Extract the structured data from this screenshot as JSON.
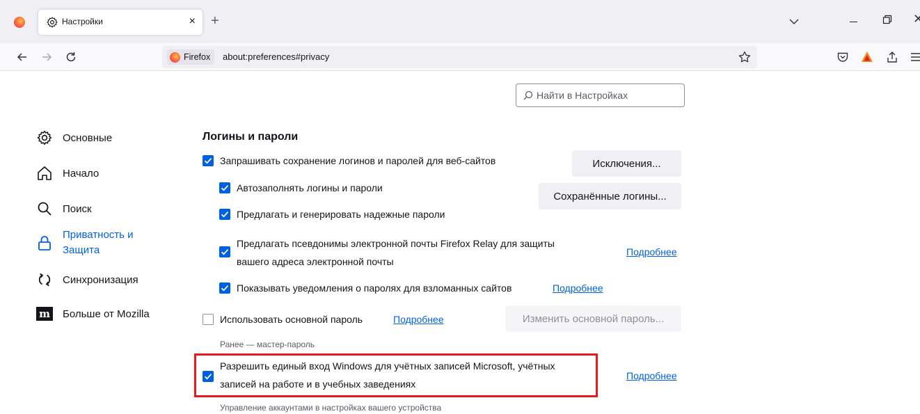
{
  "browser": {
    "tab": {
      "title": "Настройки",
      "close": "×"
    },
    "new_tab": "+",
    "url": {
      "identity": "Firefox",
      "address": "about:preferences#privacy"
    }
  },
  "search": {
    "placeholder": "Найти в Настройках"
  },
  "sidebar": {
    "items": [
      {
        "label": "Основные",
        "icon": "gear-icon"
      },
      {
        "label": "Начало",
        "icon": "home-icon"
      },
      {
        "label": "Поиск",
        "icon": "search-icon"
      },
      {
        "label_line1": "Приватность и",
        "label_line2": "Защита",
        "icon": "lock-icon",
        "active": true
      },
      {
        "label": "Синхронизация",
        "icon": "sync-icon"
      },
      {
        "label": "Больше от Mozilla",
        "icon": "mozilla-icon"
      }
    ]
  },
  "logins": {
    "title": "Логины и пароли",
    "ask_save": {
      "label": "Запрашивать сохранение логинов и паролей для веб-сайтов",
      "checked": true
    },
    "exceptions_button": "Исключения...",
    "autofill": {
      "label": "Автозаполнять логины и пароли",
      "checked": true
    },
    "saved_logins_button": "Сохранённые логины...",
    "suggest_passwords": {
      "label": "Предлагать и генерировать надежные пароли",
      "checked": true
    },
    "relay": {
      "label_line1": "Предлагать псевдонимы электронной почты Firefox Relay для защиты",
      "label_line2": "вашего адреса электронной почты",
      "checked": true,
      "link": "Подробнее"
    },
    "breach_alerts": {
      "label": "Показывать уведомления о паролях для взломанных сайтов",
      "checked": true,
      "link": "Подробнее"
    },
    "primary_password": {
      "label": "Использовать основной пароль",
      "checked": false,
      "link": "Подробнее"
    },
    "change_primary_button": "Изменить основной пароль...",
    "primary_note": "Ранее — мастер-пароль",
    "windows_sso": {
      "label_line1": "Разрешить единый вход Windows для учётных записей Microsoft, учётных",
      "label_line2": "записей на работе и в учебных заведениях",
      "checked": true,
      "link": "Подробнее"
    },
    "accounts_note": "Управление аккаунтами в настройках вашего устройства"
  },
  "colors": {
    "accent": "#0061e0",
    "highlight": "#e8191a"
  }
}
